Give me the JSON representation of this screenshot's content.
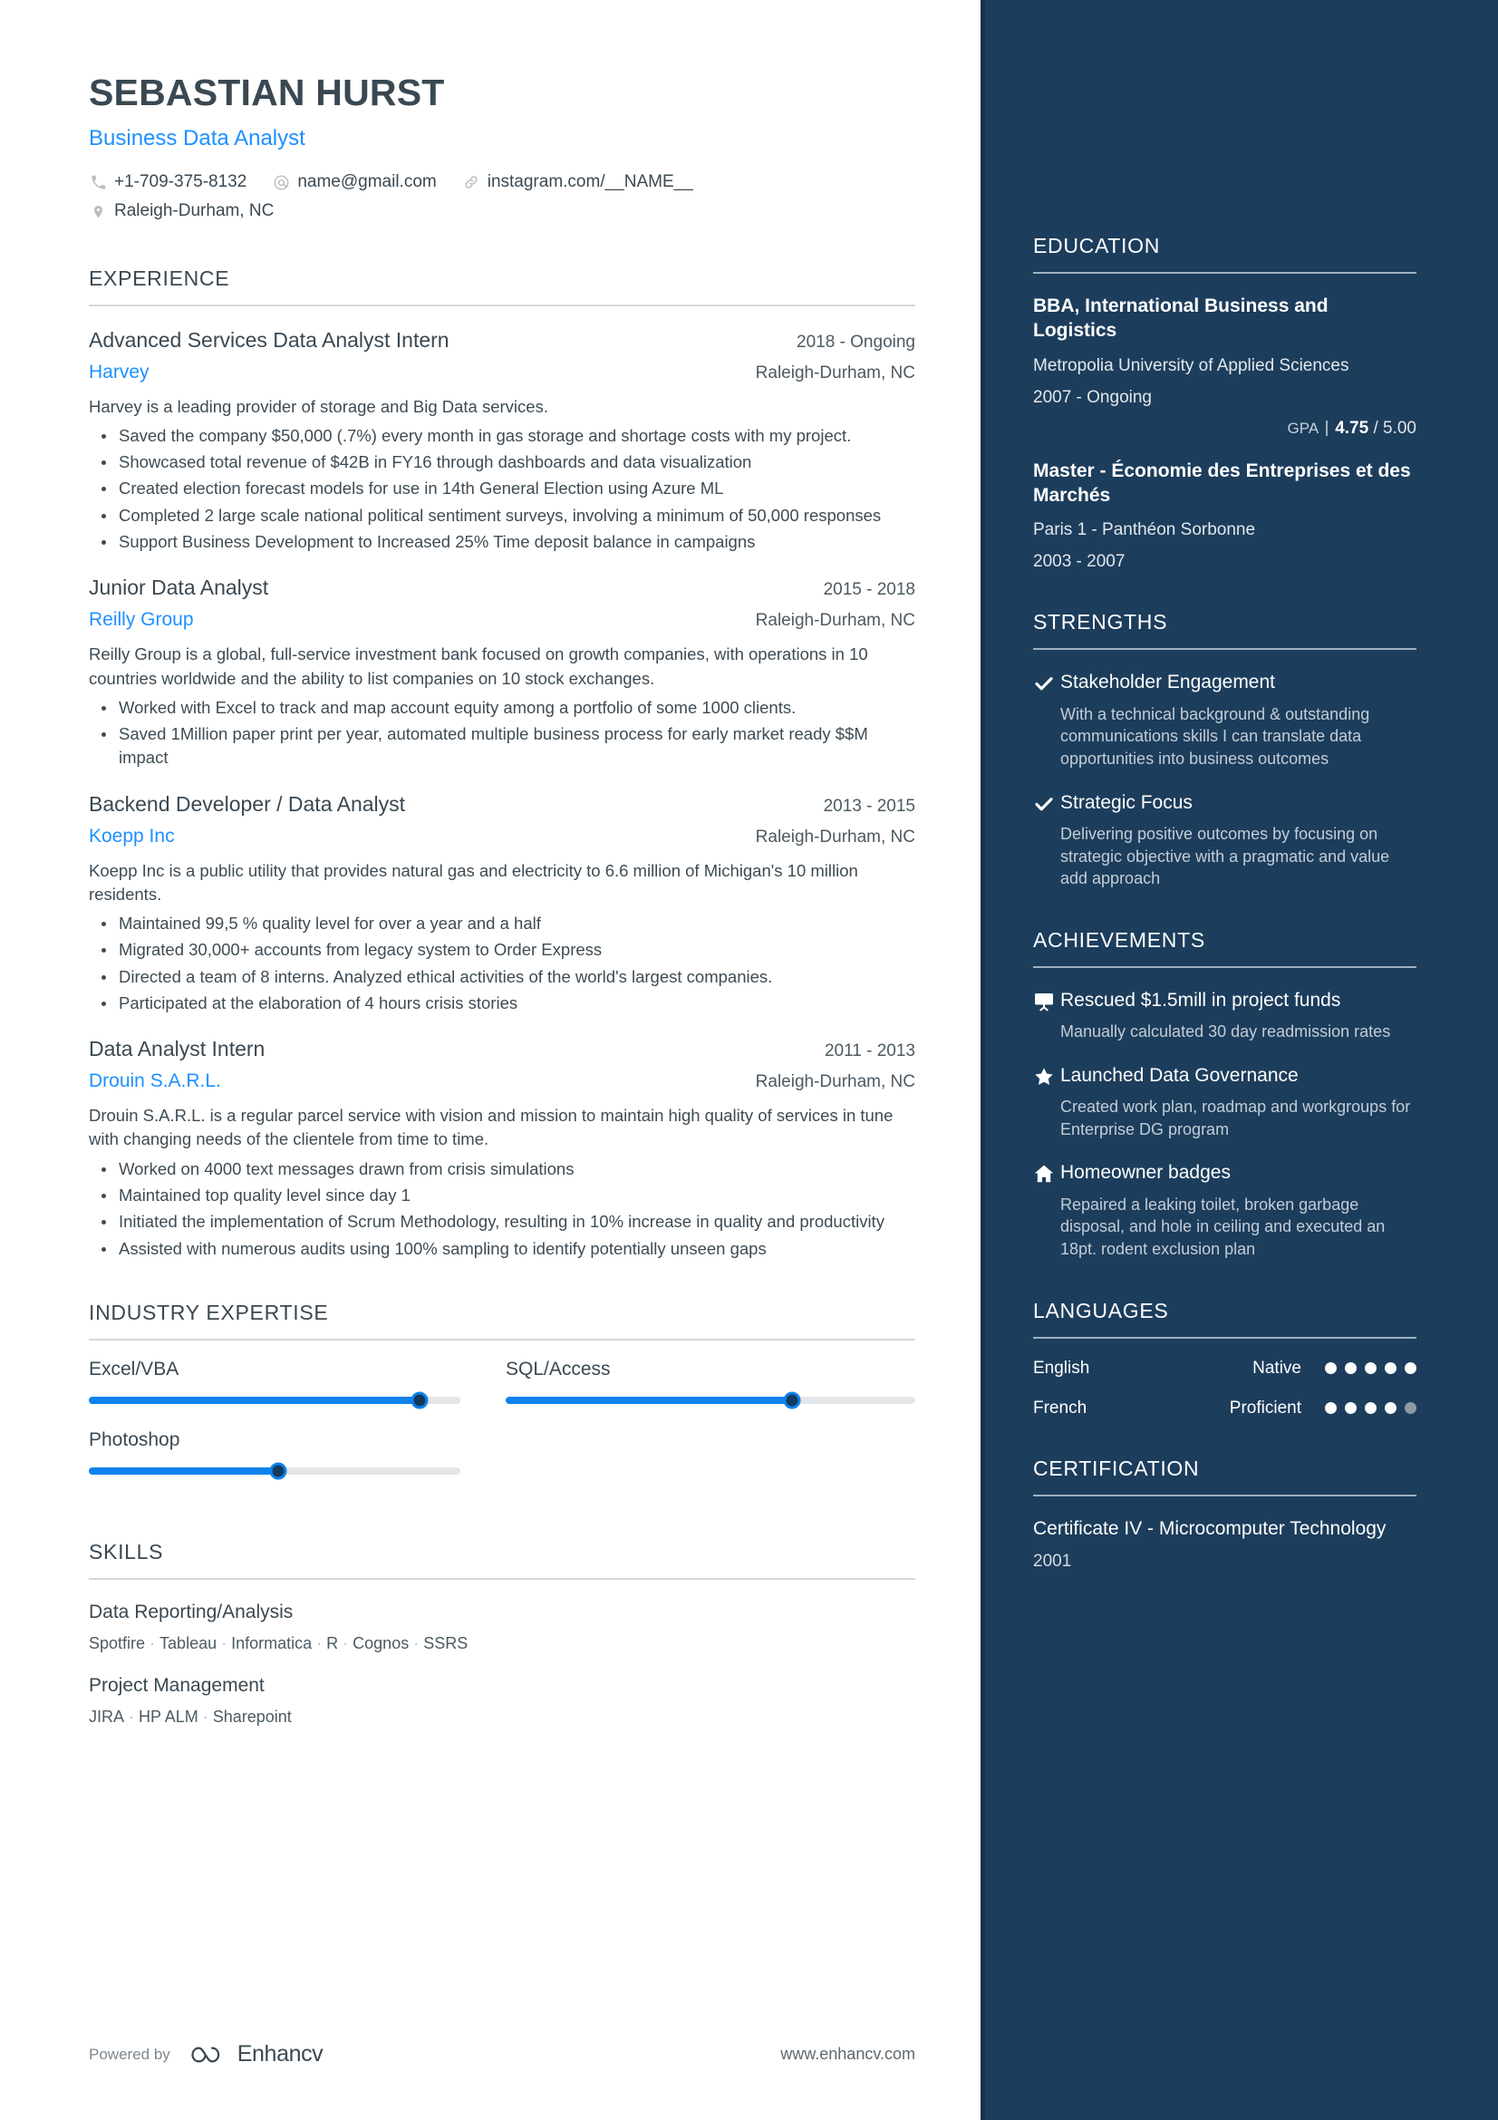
{
  "header": {
    "name": "SEBASTIAN HURST",
    "title": "Business Data Analyst",
    "contacts": [
      {
        "icon": "phone-icon",
        "text": "+1-709-375-8132"
      },
      {
        "icon": "email-icon",
        "text": "name@gmail.com"
      },
      {
        "icon": "link-icon",
        "text": "instagram.com/__NAME__"
      },
      {
        "icon": "location-pin-icon",
        "text": "Raleigh-Durham, NC"
      }
    ]
  },
  "experience": {
    "title": "EXPERIENCE",
    "jobs": [
      {
        "position": "Advanced Services Data Analyst Intern",
        "dates": "2018 - Ongoing",
        "company": "Harvey",
        "location": "Raleigh-Durham, NC",
        "description": "Harvey is a leading provider of storage and Big Data services.",
        "bullets": [
          "Saved the company $50,000 (.7%) every month in gas storage and shortage costs with my project.",
          "Showcased total revenue of $42B in FY16 through dashboards and data visualization",
          "Created election forecast models for use in 14th General Election using Azure ML",
          "Completed 2 large scale national political sentiment surveys, involving a minimum of 50,000 responses",
          "Support Business Development to Increased 25% Time deposit balance in campaigns"
        ]
      },
      {
        "position": "Junior Data Analyst",
        "dates": "2015 - 2018",
        "company": "Reilly Group",
        "location": "Raleigh-Durham, NC",
        "description": "Reilly Group is a global, full-service investment bank focused on growth companies, with operations in 10 countries worldwide and the ability to list companies on 10 stock exchanges.",
        "bullets": [
          "Worked with Excel to track and map account equity among a portfolio of some 1000 clients.",
          "Saved 1Million paper print per year, automated multiple business process for early market ready $$M impact"
        ]
      },
      {
        "position": "Backend Developer / Data Analyst",
        "dates": "2013 - 2015",
        "company": "Koepp Inc",
        "location": "Raleigh-Durham, NC",
        "description": "Koepp Inc is a public utility that provides natural gas and electricity to 6.6 million of Michigan's 10 million residents.",
        "bullets": [
          "Maintained 99,5 % quality level for over a year and a half",
          "Migrated 30,000+ accounts from legacy system to Order Express",
          "Directed a team of 8 interns. Analyzed ethical activities of the world's largest companies.",
          "Participated at the elaboration of 4 hours crisis stories"
        ]
      },
      {
        "position": "Data Analyst Intern",
        "dates": "2011 - 2013",
        "company": "Drouin S.A.R.L.",
        "location": "Raleigh-Durham, NC",
        "description": "Drouin S.A.R.L. is a regular parcel service with vision and mission to maintain high quality of services in tune with changing needs of the clientele from time to time.",
        "bullets": [
          "Worked on 4000 text messages drawn from crisis simulations",
          "Maintained top quality level since day 1",
          "Initiated the implementation of Scrum Methodology, resulting in 10% increase in quality and productivity",
          "Assisted with numerous audits using 100% sampling to identify potentially unseen gaps"
        ]
      }
    ]
  },
  "industry_expertise": {
    "title": "INDUSTRY EXPERTISE",
    "items": [
      {
        "label": "Excel/VBA",
        "value": 89
      },
      {
        "label": "SQL/Access",
        "value": 70
      },
      {
        "label": "Photoshop",
        "value": 51
      }
    ]
  },
  "skills": {
    "title": "SKILLS",
    "groups": [
      {
        "name": "Data Reporting/Analysis",
        "tags": [
          "Spotfire",
          "Tableau",
          "Informatica",
          "R",
          "Cognos",
          "SSRS"
        ]
      },
      {
        "name": "Project Management",
        "tags": [
          "JIRA",
          "HP ALM",
          "Sharepoint"
        ]
      }
    ]
  },
  "footer": {
    "powered_by": "Powered by",
    "brand": "Enhancv",
    "url": "www.enhancv.com"
  },
  "education": {
    "title": "EDUCATION",
    "entries": [
      {
        "degree": "BBA, International Business and Logistics",
        "school": "Metropolia University of Applied Sciences",
        "years": "2007 - Ongoing",
        "gpa_label": "GPA",
        "gpa_value": "4.75",
        "gpa_scale": "/ 5.00"
      },
      {
        "degree": "Master - Économie des Entreprises et des Marchés",
        "school": "Paris 1 - Panthéon Sorbonne",
        "years": "2003 - 2007"
      }
    ]
  },
  "strengths": {
    "title": "STRENGTHS",
    "items": [
      {
        "icon": "check-icon",
        "heading": "Stakeholder Engagement",
        "description": "With a technical background & outstanding communications skills I can translate data opportunities into business outcomes"
      },
      {
        "icon": "check-icon",
        "heading": "Strategic Focus",
        "description": "Delivering positive outcomes by focusing on strategic objective with a pragmatic and value add approach"
      }
    ]
  },
  "achievements": {
    "title": "ACHIEVEMENTS",
    "items": [
      {
        "icon": "presentation-board-icon",
        "heading": "Rescued $1.5mill in project funds",
        "description": "Manually calculated 30 day readmission rates"
      },
      {
        "icon": "star-icon",
        "heading": "Launched Data Governance",
        "description": "Created work plan, roadmap and workgroups for Enterprise DG program"
      },
      {
        "icon": "home-icon",
        "heading": "Homeowner badges",
        "description": "Repaired a leaking toilet, broken garbage disposal, and hole in ceiling and executed an 18pt. rodent exclusion plan"
      }
    ]
  },
  "languages": {
    "title": "LANGUAGES",
    "items": [
      {
        "name": "English",
        "level": "Native",
        "dots": 5,
        "total": 5
      },
      {
        "name": "French",
        "level": "Proficient",
        "dots": 4,
        "total": 5
      }
    ]
  },
  "certification": {
    "title": "CERTIFICATION",
    "entries": [
      {
        "name": "Certificate IV - Microcomputer Technology",
        "year": "2001"
      }
    ]
  },
  "colors": {
    "accent_blue": "#1e90ff",
    "sidebar_bg": "#1d3d5c",
    "slider_blue": "#0d82ec",
    "text_dark": "#3a4852"
  }
}
